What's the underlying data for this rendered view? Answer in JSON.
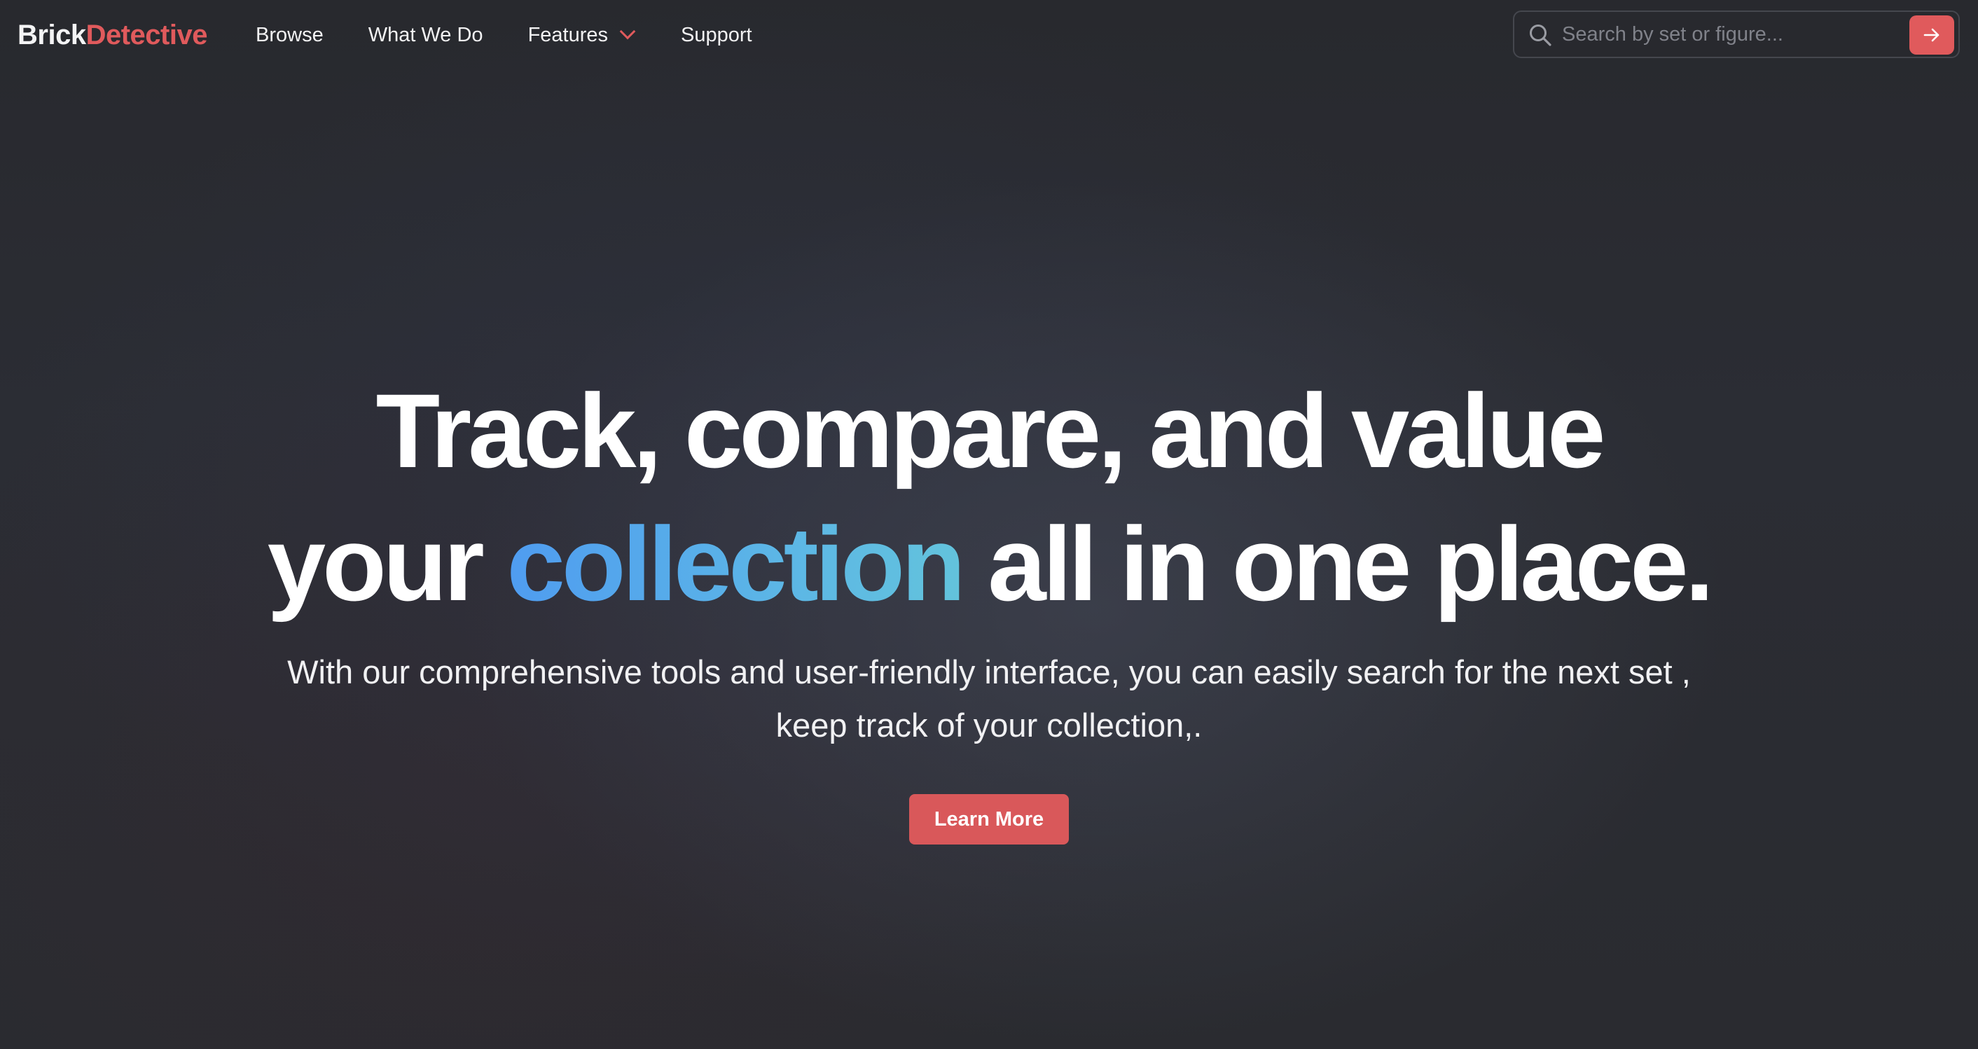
{
  "brand": {
    "part1": "Brick",
    "part2": "Detective",
    "accent_color": "#e05a5c"
  },
  "nav": {
    "items": [
      {
        "label": "Browse"
      },
      {
        "label": "What We Do"
      },
      {
        "label": "Features",
        "has_dropdown": true
      },
      {
        "label": "Support"
      }
    ]
  },
  "search": {
    "placeholder": "Search by set or figure...",
    "value": "",
    "icon": "search-icon",
    "submit_icon": "arrow-right-icon"
  },
  "hero": {
    "headline_line1": "Track, compare, and value",
    "headline_line2_before": "your ",
    "headline_line2_accent": "collection",
    "headline_line2_after": " all in one place.",
    "subtext": "With our comprehensive tools and user-friendly interface, you can easily search for the next set , keep track of your collection,.",
    "cta_label": "Learn More"
  },
  "colors": {
    "primary_button": "#d9585a",
    "accent_gradient_start": "#4f9cf0",
    "accent_gradient_end": "#63c3dc"
  }
}
